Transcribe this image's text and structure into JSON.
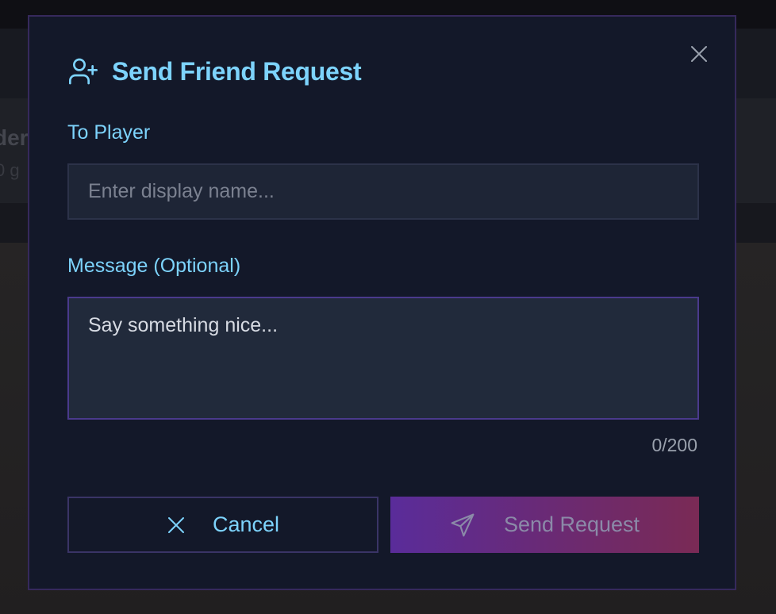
{
  "modal": {
    "title": "Send Friend Request",
    "title_icon": "user-plus-icon",
    "close_icon": "close-icon",
    "player_field": {
      "label": "To Player",
      "placeholder": "Enter display name...",
      "value": ""
    },
    "message_field": {
      "label": "Message (Optional)",
      "placeholder": "Say something nice...",
      "value": "",
      "counter": "0/200"
    },
    "buttons": {
      "cancel_label": "Cancel",
      "cancel_icon": "x-icon",
      "send_label": "Send Request",
      "send_icon": "send-icon"
    }
  },
  "colors": {
    "accent": "#7dd3fc",
    "modal_bg": "#131829",
    "modal_border": "#36295c",
    "send_gradient_start": "#5a2c9a",
    "send_gradient_end": "#7a2a55"
  }
}
